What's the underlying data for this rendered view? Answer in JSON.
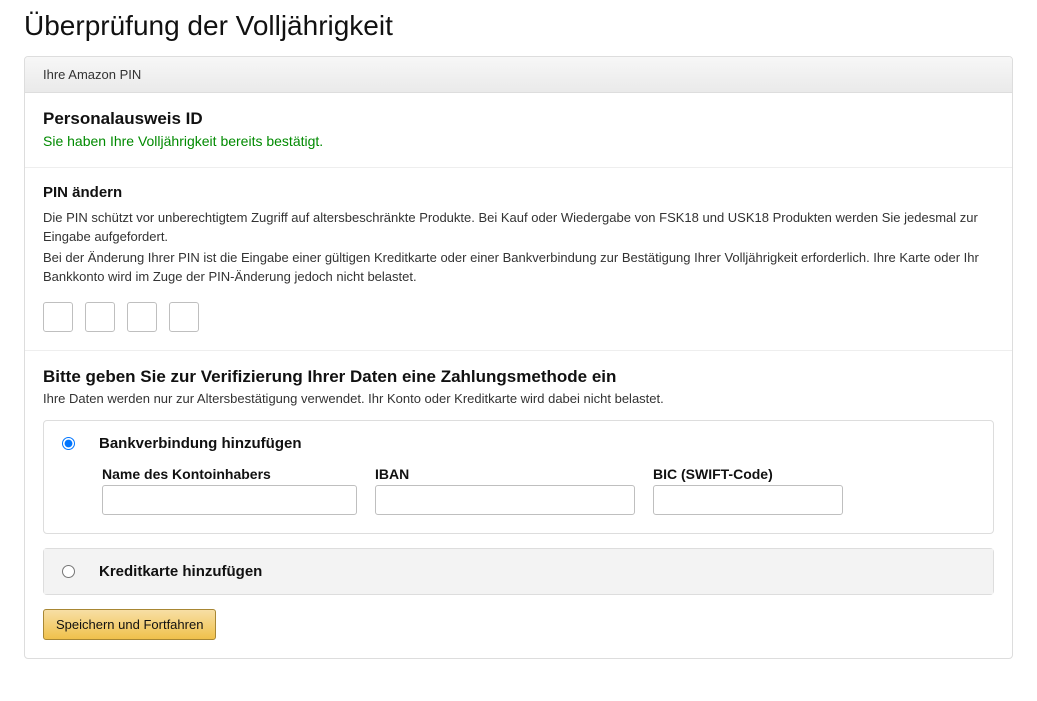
{
  "page_title": "Überprüfung der Volljährigkeit",
  "panel_header": "Ihre Amazon PIN",
  "id_section": {
    "title": "Personalausweis ID",
    "confirmed_msg": "Sie haben Ihre Volljährigkeit bereits bestätigt."
  },
  "pin_section": {
    "title": "PIN ändern",
    "desc1": "Die PIN schützt vor unberechtigtem Zugriff auf altersbeschränkte Produkte. Bei Kauf oder Wiedergabe von FSK18 und USK18 Produkten werden Sie jedesmal zur Eingabe aufgefordert.",
    "desc2": "Bei der Änderung Ihrer PIN ist die Eingabe einer gültigen Kreditkarte oder einer Bankverbindung zur Bestätigung Ihrer Volljährigkeit erforderlich. Ihre Karte oder Ihr Bankkonto wird im Zuge der PIN-Änderung jedoch nicht belastet."
  },
  "pay_section": {
    "title": "Bitte geben Sie zur Verifizierung Ihrer Daten eine Zahlungsmethode ein",
    "note": "Ihre Daten werden nur zur Altersbestätigung verwendet. Ihr Konto oder Kreditkarte wird dabei nicht belastet.",
    "bank": {
      "label": "Bankverbindung hinzufügen",
      "name_label": "Name des Kontoinhabers",
      "iban_label": "IBAN",
      "bic_label": "BIC (SWIFT-Code)"
    },
    "card": {
      "label": "Kreditkarte hinzufügen"
    }
  },
  "submit_label": "Speichern und Fortfahren"
}
